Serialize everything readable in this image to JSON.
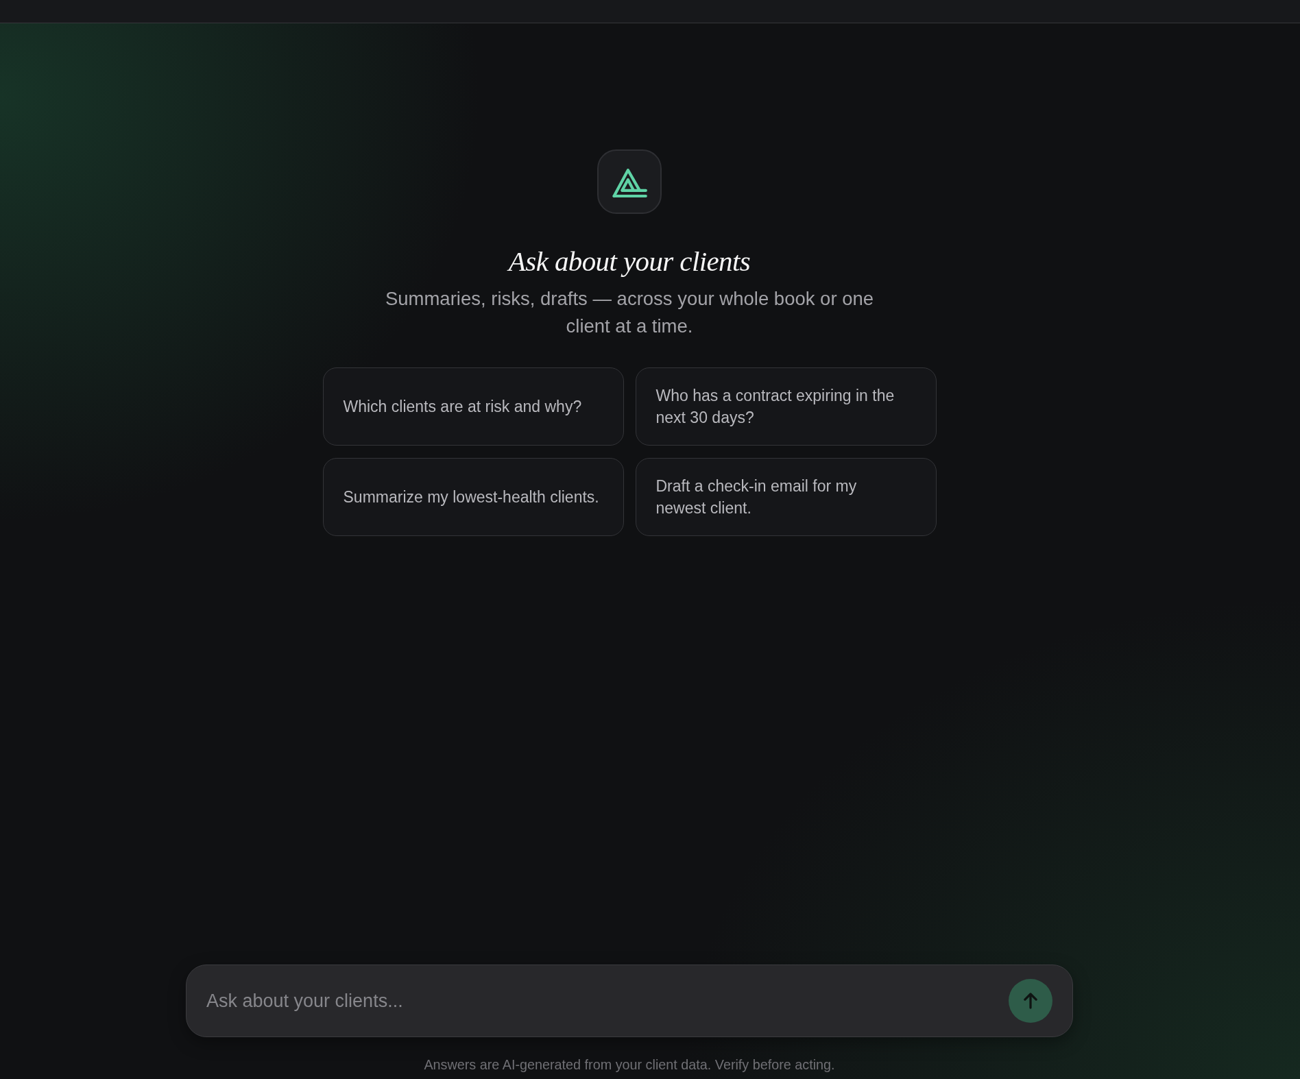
{
  "hero": {
    "title": "Ask about your clients",
    "subtitle": "Summaries, risks, drafts — across your whole book or one client at a time."
  },
  "suggestions": [
    "Which clients are at risk and why?",
    "Who has a contract expiring in the next 30 days?",
    "Summarize my lowest-health clients.",
    "Draft a check-in email for my newest client."
  ],
  "composer": {
    "placeholder": "Ask about your clients..."
  },
  "disclaimer": "Answers are AI-generated from your client data. Verify before acting."
}
